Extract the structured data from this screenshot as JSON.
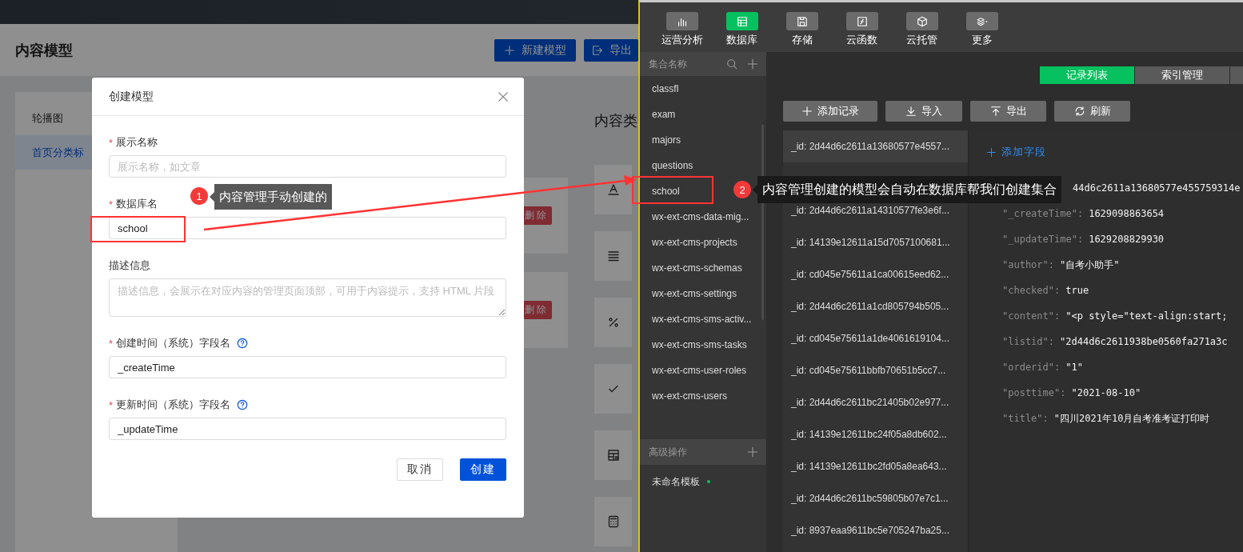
{
  "page": {
    "title": "内容模型",
    "actions": [
      {
        "label": "新建模型"
      },
      {
        "label": "导出"
      }
    ],
    "sidebar": [
      {
        "label": "轮播图",
        "selected": false
      },
      {
        "label": "首页分类标",
        "selected": true
      }
    ],
    "cards": [
      {
        "action": "删除"
      },
      {
        "action": "删除"
      }
    ],
    "content_heading": "内容类"
  },
  "modal": {
    "title": "创建模型",
    "required_mark": "*",
    "fields": [
      {
        "kind": "input",
        "label": "展示名称",
        "required": true,
        "help": false,
        "placeholder": "展示名称，如文章"
      },
      {
        "kind": "input",
        "label": "数据库名",
        "required": true,
        "help": false,
        "value": "school"
      },
      {
        "kind": "textarea",
        "label": "描述信息",
        "required": false,
        "help": false,
        "placeholder": "描述信息，会展示在对应内容的管理页面顶部，可用于内容提示，支持 HTML 片段"
      },
      {
        "kind": "input",
        "label": "创建时间（系统）字段名",
        "required": true,
        "help": true,
        "value": "_createTime"
      },
      {
        "kind": "input",
        "label": "更新时间（系统）字段名",
        "required": true,
        "help": true,
        "value": "_updateTime"
      }
    ],
    "buttons": [
      {
        "label": "取消",
        "kind": "default"
      },
      {
        "label": "创建",
        "kind": "primary"
      }
    ]
  },
  "console": {
    "toolbar": [
      {
        "label": "运营分析",
        "selected": false
      },
      {
        "label": "数据库",
        "selected": true
      },
      {
        "label": "存储",
        "selected": false
      },
      {
        "label": "云函数",
        "selected": false
      },
      {
        "label": "云托管",
        "selected": false
      },
      {
        "label": "更多",
        "selected": false
      }
    ],
    "collections": {
      "header": "集合名称",
      "items": [
        "classfl",
        "exam",
        "majors",
        "questions",
        "school",
        "wx-ext-cms-data-mig...",
        "wx-ext-cms-projects",
        "wx-ext-cms-schemas",
        "wx-ext-cms-settings",
        "wx-ext-cms-sms-activ...",
        "wx-ext-cms-sms-tasks",
        "wx-ext-cms-user-roles",
        "wx-ext-cms-users"
      ]
    },
    "advanced": {
      "header": "高级操作",
      "items": [
        {
          "name": "未命名模板",
          "unsaved": true
        }
      ]
    },
    "tabs": [
      {
        "label": "记录列表",
        "selected": true
      },
      {
        "label": "索引管理",
        "selected": false
      }
    ],
    "actions": [
      {
        "label": "添加记录"
      },
      {
        "label": "导入"
      },
      {
        "label": "导出"
      },
      {
        "label": "刷新"
      }
    ],
    "records": [
      {
        "id": "_id: 2d44d6c2611a13680577e4557...",
        "selected": true
      },
      {
        "selected": false
      },
      {
        "id": "_id: 2d44d6c2611a14310577fe3e6f...",
        "selected": false
      },
      {
        "id": "_id: 14139e12611a15d7057100681...",
        "selected": false
      },
      {
        "id": "_id: cd045e75611a1ca00615eed62...",
        "selected": false
      },
      {
        "id": "_id: 2d44d6c2611a1cd805794b505...",
        "selected": false
      },
      {
        "id": "_id: cd045e75611a1de4061619104...",
        "selected": false
      },
      {
        "id": "_id: cd045e75611bbfb70651b5cc7...",
        "selected": false
      },
      {
        "id": "_id: 2d44d6c2611bc21405b02e977...",
        "selected": false
      },
      {
        "id": "_id: 14139e12611bc24f05a8db602...",
        "selected": false
      },
      {
        "id": "_id: 14139e12611bc2fd05a8ea643...",
        "selected": false
      },
      {
        "id": "_id: 2d44d6c2611bc59805b07e7c1...",
        "selected": false
      },
      {
        "id": "_id: 8937eaa9611bc5e705247ba25...",
        "selected": false
      }
    ],
    "add_field": "添加字段",
    "fields": [
      {
        "kind": "covered",
        "value": "44d6c2611a13680577e455759314e"
      },
      {
        "kind": "pair",
        "key": "\"_createTime\":",
        "value": "1629098863654"
      },
      {
        "kind": "pair",
        "key": "\"_updateTime\":",
        "value": "1629208829930"
      },
      {
        "kind": "pair",
        "key": "\"author\":",
        "value": "\"自考小助手\""
      },
      {
        "kind": "pair",
        "key": "\"checked\":",
        "value": "true"
      },
      {
        "kind": "pair",
        "key": "\"content\":",
        "value": "\"<p style=\"text-align:start;"
      },
      {
        "kind": "pair",
        "key": "\"listid\":",
        "value": "\"2d44d6c2611938be0560fa271a3c"
      },
      {
        "kind": "pair",
        "key": "\"orderid\":",
        "value": "\"1\""
      },
      {
        "kind": "pair",
        "key": "\"posttime\":",
        "value": "\"2021-08-10\""
      },
      {
        "kind": "pair",
        "key": "\"title\":",
        "value": "\"四川2021年10月自考准考证打印时"
      }
    ]
  },
  "annotations": [
    {
      "number": "1",
      "text": "内容管理手动创建的"
    },
    {
      "number": "2",
      "text": "内容管理创建的模型会自动在数据库帮我们创建集合"
    }
  ]
}
